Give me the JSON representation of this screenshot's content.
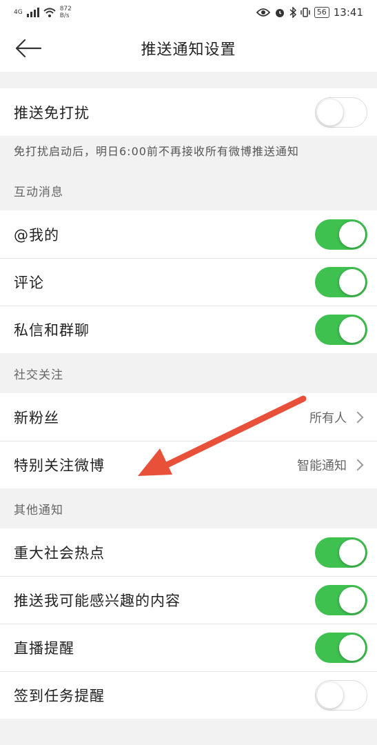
{
  "status_bar": {
    "network": "4G",
    "speed_value": "872",
    "speed_unit": "B/s",
    "battery": "56",
    "time": "13:41"
  },
  "nav": {
    "title": "推送通知设置"
  },
  "dnd": {
    "label": "推送免打扰",
    "enabled": false,
    "note": "免打扰启动后，明日6:00前不再接收所有微博推送通知"
  },
  "interaction": {
    "header": "互动消息",
    "items": [
      {
        "label": "@我的",
        "enabled": true
      },
      {
        "label": "评论",
        "enabled": true
      },
      {
        "label": "私信和群聊",
        "enabled": true
      }
    ]
  },
  "social": {
    "header": "社交关注",
    "items": [
      {
        "label": "新粉丝",
        "value": "所有人"
      },
      {
        "label": "特别关注微博",
        "value": "智能通知"
      }
    ]
  },
  "other": {
    "header": "其他通知",
    "items": [
      {
        "label": "重大社会热点",
        "enabled": true
      },
      {
        "label": "推送我可能感兴趣的内容",
        "enabled": true
      },
      {
        "label": "直播提醒",
        "enabled": true
      },
      {
        "label": "签到任务提醒",
        "enabled": false
      }
    ]
  },
  "colors": {
    "toggle_on": "#3fc150",
    "annotation_arrow": "#e8503a"
  }
}
